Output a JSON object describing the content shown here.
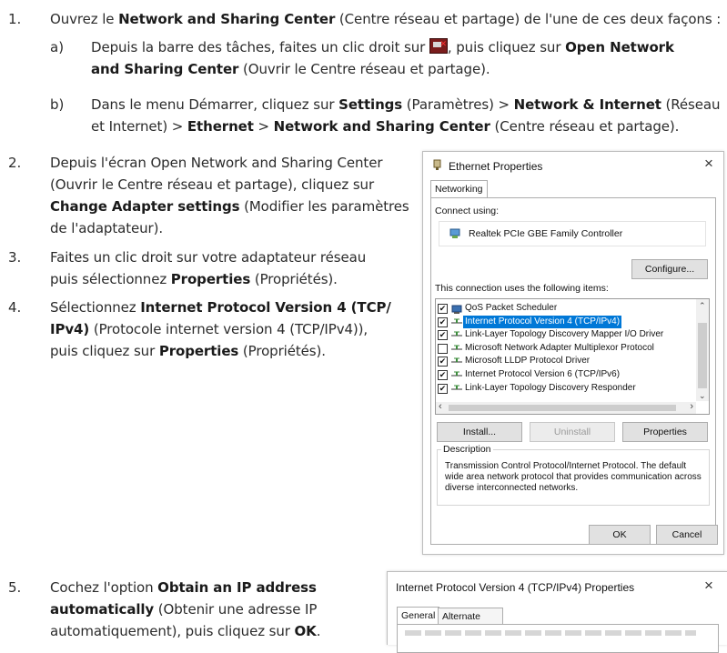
{
  "steps": {
    "s1": {
      "num": "1.",
      "pre": "Ouvrez le ",
      "b1": "Network and Sharing Center",
      "post": " (Centre réseau et partage) de l'une de ces deux façons :",
      "a": {
        "letter": "a)",
        "l1_pre": "Depuis la barre des tâches, faites un clic droit sur ",
        "l1_post": ", puis cliquez sur ",
        "l1_b": "Open Network",
        "l2_b": "and Sharing Center",
        "l2_post": " (Ouvrir le Centre réseau et partage)."
      },
      "b": {
        "letter": "b)",
        "l1_pre": "Dans le menu Démarrer, cliquez sur ",
        "b1": "Settings",
        "m1": " (Paramètres) > ",
        "b2": "Network & Internet",
        "m2": " (Réseau",
        "l2_pre": "et Internet) > ",
        "b3": "Ethernet",
        "m3": " > ",
        "b4": "Network and Sharing Center",
        "m4": " (Centre réseau et partage)."
      }
    },
    "s2": {
      "num": "2.",
      "l1": "Depuis l'écran Open Network and Sharing Center",
      "l2": "(Ouvrir le Centre réseau et partage), cliquez sur",
      "l3_b": "Change Adapter settings",
      "l3_post": " (Modifier les paramètres",
      "l4": "de l'adaptateur)."
    },
    "s3": {
      "num": "3.",
      "l1": "Faites un clic droit sur votre adaptateur réseau",
      "l2_pre": "puis sélectionnez ",
      "l2_b": "Properties",
      "l2_post": " (Propriétés)."
    },
    "s4": {
      "num": "4.",
      "l1_pre": "Sélectionnez ",
      "l1_b": "Internet Protocol Version 4 (TCP/",
      "l2_b": "IPv4)",
      "l2_post": " (Protocole internet version 4 (TCP/IPv4)),",
      "l3_pre": "puis cliquez sur ",
      "l3_b": "Properties",
      "l3_post": " (Propriétés)."
    },
    "s5": {
      "num": "5.",
      "l1_pre": "Cochez l'option ",
      "l1_b": "Obtain an IP address",
      "l2_b": "automatically",
      "l2_post": " (Obtenir une adresse IP",
      "l3_pre": "automatiquement), puis cliquez sur ",
      "l3_b": "OK",
      "l3_post": "."
    }
  },
  "eth_dialog": {
    "title": "Ethernet Properties",
    "close": "×",
    "tab": "Networking",
    "connect_using": "Connect using:",
    "adapter": "Realtek PCIe GBE Family Controller",
    "configure": "Configure...",
    "items_label": "This connection uses the following items:",
    "items": [
      {
        "label": "QoS Packet Scheduler",
        "checked": true,
        "selected": false
      },
      {
        "label": "Internet Protocol Version 4 (TCP/IPv4)",
        "checked": true,
        "selected": true
      },
      {
        "label": "Link-Layer Topology Discovery Mapper I/O Driver",
        "checked": true,
        "selected": false
      },
      {
        "label": "Microsoft Network Adapter Multiplexor Protocol",
        "checked": false,
        "selected": false
      },
      {
        "label": "Microsoft LLDP Protocol Driver",
        "checked": true,
        "selected": false
      },
      {
        "label": "Internet Protocol Version 6 (TCP/IPv6)",
        "checked": true,
        "selected": false
      },
      {
        "label": "Link-Layer Topology Discovery Responder",
        "checked": true,
        "selected": false
      }
    ],
    "install": "Install...",
    "uninstall": "Uninstall",
    "properties": "Properties",
    "description_label": "Description",
    "description": "Transmission Control Protocol/Internet Protocol. The default wide area network protocol that provides communication across diverse interconnected networks.",
    "ok": "OK",
    "cancel": "Cancel"
  },
  "ipv4_dialog": {
    "title": "Internet Protocol Version 4 (TCP/IPv4) Properties",
    "close": "×",
    "tab_general": "General",
    "tab_alternate": "Alternate Configuration"
  }
}
